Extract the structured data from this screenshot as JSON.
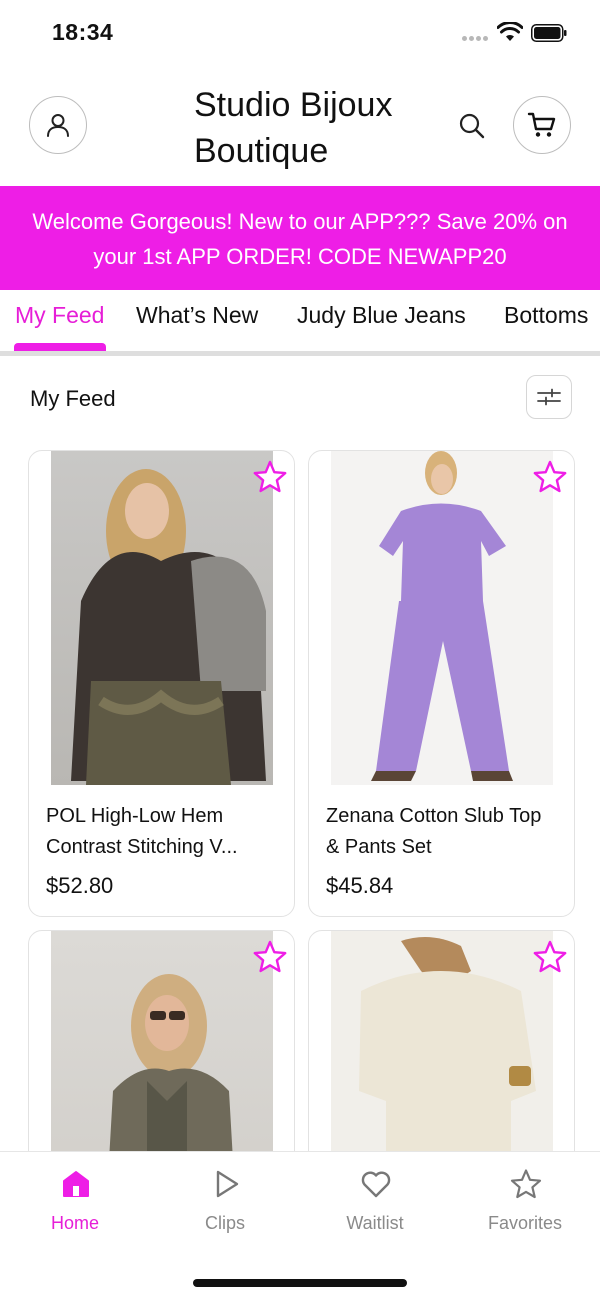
{
  "status_bar": {
    "time": "18:34"
  },
  "header": {
    "title": "Studio Bijoux Boutique"
  },
  "promo": {
    "text": "Welcome Gorgeous! New to our APP??? Save 20% on your 1st APP ORDER! CODE NEWAPP20"
  },
  "tabs": [
    {
      "label": "My Feed",
      "active": true
    },
    {
      "label": "What’s New"
    },
    {
      "label": "Judy Blue Jeans"
    },
    {
      "label": "Bottoms"
    }
  ],
  "feed": {
    "title": "My Feed"
  },
  "products": [
    {
      "name": "POL High-Low Hem Contrast Stitching V...",
      "price": "$52.80"
    },
    {
      "name": "Zenana Cotton Slub Top & Pants Set",
      "price": "$45.84"
    },
    {
      "name": "",
      "price": ""
    },
    {
      "name": "",
      "price": ""
    }
  ],
  "bottom_nav": [
    {
      "label": "Home",
      "icon": "home-icon",
      "active": true
    },
    {
      "label": "Clips",
      "icon": "play-icon"
    },
    {
      "label": "Waitlist",
      "icon": "heart-icon"
    },
    {
      "label": "Favorites",
      "icon": "star-icon"
    }
  ],
  "colors": {
    "brand": "#ee1ee6",
    "active_text": "#e61ed7"
  }
}
